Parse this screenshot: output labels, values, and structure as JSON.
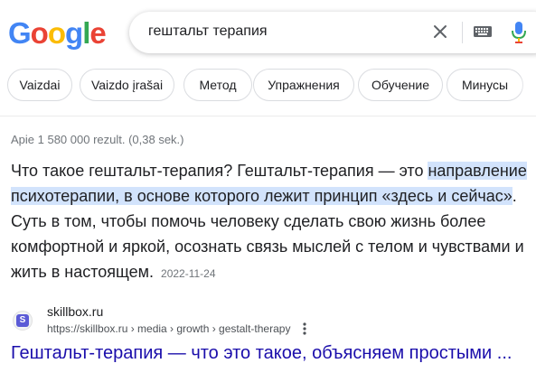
{
  "logo": {
    "letters": [
      "G",
      "o",
      "o",
      "g",
      "l",
      "e"
    ],
    "colors": [
      "#4285f4",
      "#ea4335",
      "#fbbc05",
      "#4285f4",
      "#34a853",
      "#ea4335"
    ]
  },
  "search": {
    "query": "гештальт терапия"
  },
  "icons": {
    "clear": "close-icon",
    "keyboard": "keyboard-icon",
    "mic": "microphone-icon",
    "more": "more-vert-icon"
  },
  "chips": [
    "Vaizdai",
    "Vaizdo įrašai",
    "Метод",
    "Упражнения",
    "Обучение",
    "Минусы"
  ],
  "stats": "Apie 1 580 000 rezult. (0,38 sek.)",
  "snippet": {
    "before": "Что такое гештальт-терапия? Гештальт-терапия — это ",
    "highlight": "направление психотерапии, в основе которого лежит принцип «здесь и сейчас»",
    "after": ". Суть в том, чтобы помочь человеку сделать свою жизнь более комфортной и яркой, осознать связь мыслей с телом и чувствами и жить в настоящем.",
    "date": "2022-11-24"
  },
  "result": {
    "favicon_letter": "S",
    "site_name": "skillbox.ru",
    "url": "https://skillbox.ru › media › growth › gestalt-therapy",
    "title": "Гештальт-терапия — что это такое, объясняем простыми ..."
  },
  "colors": {
    "link": "#1a0dab",
    "highlight": "#d2e3fc",
    "muted": "#70757a"
  }
}
